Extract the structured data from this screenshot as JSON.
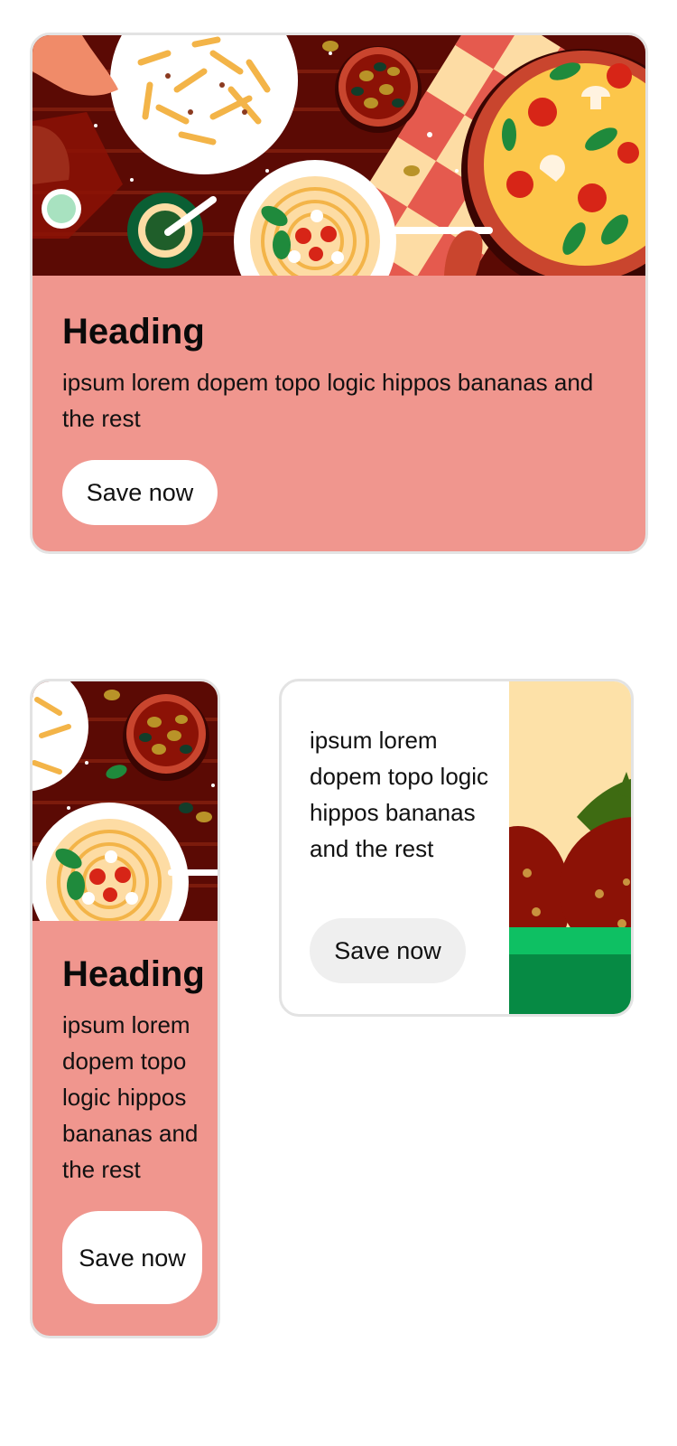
{
  "cards": [
    {
      "heading": "Heading",
      "body": "ipsum lorem dopem topo logic hippos bananas and the rest",
      "button": "Save now",
      "image": "food-table-illustration"
    },
    {
      "heading": "Heading",
      "body": "ipsum lorem dopem topo logic hippos bananas and the rest",
      "button": "Save now",
      "image": "food-table-illustration"
    },
    {
      "body": "ipsum lorem dopem topo logic hippos bananas and the rest",
      "button": "Save now",
      "image": "tomato-leaf-illustration"
    }
  ],
  "colors": {
    "card_pink": "#f0968e",
    "card_border": "#e3e3e3",
    "button_white": "#ffffff",
    "button_grey": "#efefef",
    "table_dark_red": "#5b0a04",
    "tablecloth_red": "#e55a4e",
    "tablecloth_cream": "#fddca4",
    "pizza_crust": "#c9452e",
    "cheese": "#fcc64a",
    "basil_green": "#1f8a3c",
    "grass_bright": "#0ec063",
    "grass_dark": "#068a44",
    "tomato_red": "#8c1206"
  }
}
